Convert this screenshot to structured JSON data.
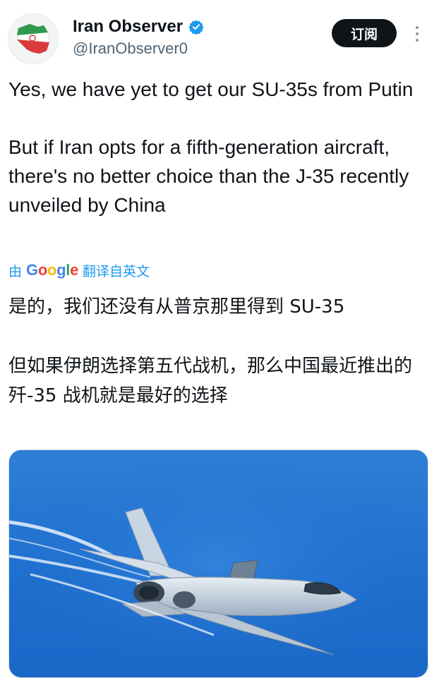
{
  "author": {
    "display_name": "Iran Observer",
    "handle": "@IranObserver0",
    "verified": true,
    "avatar_icon": "iran-map-flag-icon"
  },
  "actions": {
    "subscribe_label": "订阅",
    "more_icon": "more-vertical-icon"
  },
  "tweet": {
    "text": "Yes, we have yet to get our SU-35s from Putin\n\nBut if Iran opts for a fifth-generation aircraft, there's no better choice than the J-35 recently unveiled by China",
    "translation": {
      "by_label": "由",
      "provider": "Google",
      "action_label": "翻译自英文",
      "text": "是的，我们还没有从普京那里得到 SU-35\n\n但如果伊朗选择第五代战机，那么中国最近推出的歼-35 战机就是最好的选择"
    }
  },
  "media": {
    "type": "photo",
    "subject_icon": "fighter-jet-icon"
  },
  "colors": {
    "accent": "#1d9bf0",
    "text": "#0f1419",
    "secondary": "#536471",
    "button_bg": "#0f1419",
    "sky": "#1f6fcf"
  }
}
